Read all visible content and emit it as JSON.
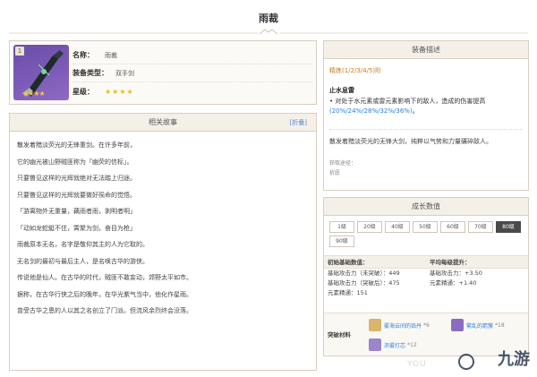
{
  "page": {
    "title": "雨裁"
  },
  "item": {
    "badge": "1",
    "stars_image": "★★★★",
    "fields": [
      {
        "label": "名称：",
        "value": "雨裁"
      },
      {
        "label": "装备类型：",
        "value": "双手剑"
      },
      {
        "label": "星级：",
        "value": "★★★★"
      }
    ]
  },
  "story": {
    "header": "相关故事",
    "toggle": "[折叠]",
    "lines": [
      "散发着黯淡荧光的无锋重剑。在许多年前，",
      "它的幽光被山野贼匪称为「幽荧的信标」。",
      "只要瞥见这样的光辉就绝对无法踏上归途。",
      "只要瞥见这样的光辉就要做好殒命的觉悟。",
      "「游离物外无重量，藕雨者雨，剥明者明」",
      "「动如龙蛇蜓不住，霄聚为剑，奋目为枪」",
      "雨裁原本无名，名字是敬仰其主的人为它取的。",
      "无名剑的最初与最后主人，是名唤古华的游侠。",
      "传说他是仙人。在古华的时代，贼匪不敢妄动，郊野太平如市。",
      "据称，在古华行侠之后的晚年，在华光紫气当中，他化作星雨。",
      "曾受古华之恩的人以其之名创立了门派。但流风余烈终会没落。"
    ]
  },
  "description": {
    "header": "装备描述",
    "refine": "精炼(1/2/3/4/5)阶",
    "passive_name": "止水息雷",
    "passive_text_prefix": "• 对处于水元素或雷元素影响下的敌人，造成的伤害提高",
    "passive_values": "(20%/24%/28%/32%/36%)",
    "passive_text_suffix": "。",
    "flavor": "散发着黯淡荧光的无锋大剑，纯粹以气势和力量碾碎敌人。",
    "acquisition_label": "获取途径：",
    "acquisition_value": "祈愿"
  },
  "growth": {
    "header": "成长数值",
    "levels": [
      "1级",
      "20级",
      "40级",
      "50级",
      "60级",
      "70级",
      "80级",
      "90级"
    ],
    "active_level": "80级",
    "headers": {
      "left": "初始基础数值：",
      "right": "平均每级提升："
    },
    "left_stats": [
      "基础攻击力（未突破）：449",
      "基础攻击力（突破后）：475",
      "元素精通：151"
    ],
    "right_stats": [
      "基础攻击力：+3.50",
      "元素精通：+1.40"
    ],
    "materials_label": "突破材料",
    "materials": [
      {
        "name": "雾海云间的铅丹",
        "qty": "*6"
      },
      {
        "name": "繁乱的箭簇",
        "qty": "*18"
      },
      {
        "name": "浓雾灯芯",
        "qty": "*12"
      }
    ]
  },
  "watermark": {
    "brand": "九游",
    "faded": "YOU"
  },
  "colors": {
    "accent_blue": "#2a7fd6",
    "refine_orange": "#c57d22",
    "star_gold": "#f2b718",
    "panel_bg": "#f4f0e8",
    "border": "#d8cfc0"
  }
}
